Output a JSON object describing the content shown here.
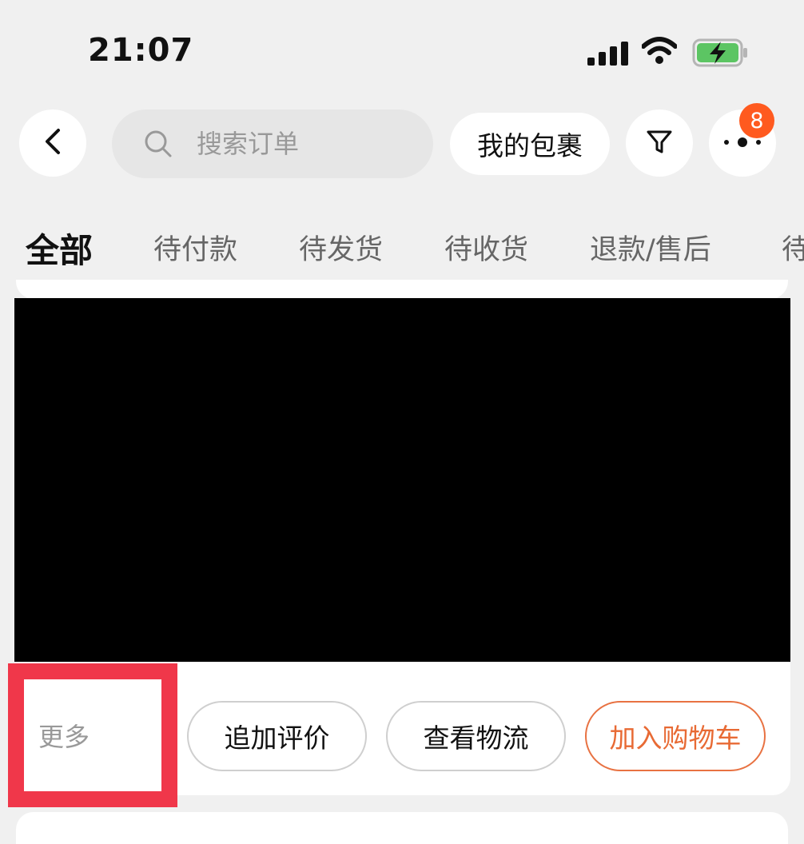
{
  "status_bar": {
    "time": "21:07",
    "signal_icon": "cellular-signal-icon",
    "wifi_icon": "wifi-icon",
    "battery_icon": "battery-charging-icon"
  },
  "header": {
    "back_icon": "chevron-left-icon",
    "search": {
      "placeholder": "搜索订单",
      "icon": "search-icon"
    },
    "parcel_button": "我的包裹",
    "filter_icon": "filter-icon",
    "more_icon": "more-dots-icon",
    "more_badge": "8"
  },
  "tabs": [
    {
      "label": "全部",
      "active": true
    },
    {
      "label": "待付款",
      "active": false
    },
    {
      "label": "待发货",
      "active": false
    },
    {
      "label": "待收货",
      "active": false
    },
    {
      "label": "退款/售后",
      "active": false
    },
    {
      "label": "待",
      "active": false
    }
  ],
  "order_card": {
    "more_label": "更多",
    "actions": {
      "add_review": "追加评价",
      "view_logistics": "查看物流",
      "add_to_cart": "加入购物车"
    }
  },
  "colors": {
    "accent": "#e86a34",
    "badge": "#ff5a1f",
    "highlight": "#f0374a",
    "background": "#f0f0f0"
  }
}
